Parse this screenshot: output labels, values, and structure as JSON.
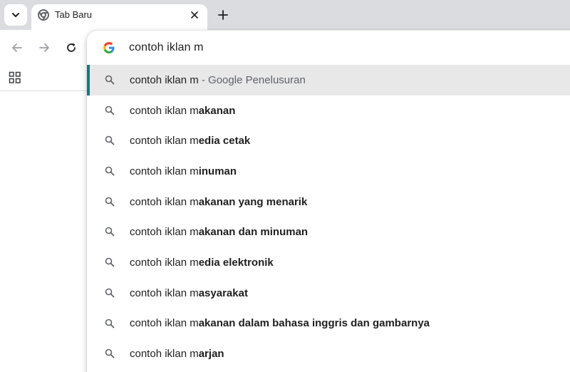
{
  "tab": {
    "title": "Tab Baru"
  },
  "omnibox": {
    "input_value": "contoh iklan m",
    "suggestions": [
      {
        "prefix": "contoh iklan m",
        "bold": "",
        "suffix": " - Google Penelusuran",
        "selected": true
      },
      {
        "prefix": "contoh iklan m",
        "bold": "akanan",
        "suffix": ""
      },
      {
        "prefix": "contoh iklan m",
        "bold": "edia cetak",
        "suffix": ""
      },
      {
        "prefix": "contoh iklan m",
        "bold": "inuman",
        "suffix": ""
      },
      {
        "prefix": "contoh iklan m",
        "bold": "akanan yang menarik",
        "suffix": ""
      },
      {
        "prefix": "contoh iklan m",
        "bold": "akanan dan minuman",
        "suffix": ""
      },
      {
        "prefix": "contoh iklan m",
        "bold": "edia elektronik",
        "suffix": ""
      },
      {
        "prefix": "contoh iklan m",
        "bold": "asyarakat",
        "suffix": ""
      },
      {
        "prefix": "contoh iklan m",
        "bold": "akanan dalam bahasa inggris dan gambarnya",
        "suffix": ""
      },
      {
        "prefix": "contoh iklan m",
        "bold": "arjan",
        "suffix": ""
      }
    ]
  },
  "icons": {
    "tab_search": "chevron-down-icon",
    "favicon": "chrome-icon",
    "close": "close-icon",
    "new_tab": "plus-icon",
    "back": "arrow-left-icon",
    "forward": "arrow-right-icon",
    "reload": "reload-icon",
    "apps": "apps-grid-icon",
    "google": "google-g-icon",
    "search": "search-icon"
  },
  "colors": {
    "selected_indicator": "#0b7f7a",
    "selected_row": "#e8e8e8",
    "tabstrip": "#dadce0"
  }
}
